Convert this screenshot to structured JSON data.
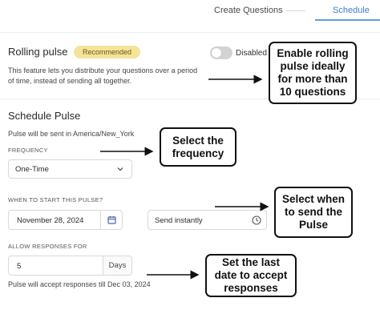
{
  "tabs": {
    "create_questions": "Create Questions",
    "schedule": "Schedule",
    "active": "Schedule"
  },
  "rolling_pulse": {
    "title": "Rolling pulse",
    "badge": "Recommended",
    "toggle_label": "Disabled",
    "toggle_enabled": false,
    "description": "This feature lets you distribute your questions over a period of time, instead of sending all together."
  },
  "schedule_pulse": {
    "title": "Schedule Pulse",
    "timezone_note": "Pulse will be sent in America/New_York",
    "frequency": {
      "label": "FREQUENCY",
      "value": "One-Time"
    },
    "when_to_start": {
      "label": "WHEN TO START THIS PULSE?",
      "date_value": "November 28, 2024",
      "send_value": "Send instantly"
    },
    "allow_responses": {
      "label": "ALLOW RESPONSES FOR",
      "value": "5",
      "unit": "Days"
    },
    "accept_note": "Pulse will accept responses till Dec 03, 2024"
  },
  "callouts": {
    "rolling": "Enable rolling pulse ideally for more than 10 questions",
    "frequency": "Select the frequency",
    "send_time": "Select when to send the Pulse",
    "last_date": "Set the last date to accept responses"
  },
  "colors": {
    "accent": "#5aa0d8",
    "badge_bg": "#f6e39a",
    "calendar_icon": "#4a63b8"
  },
  "icons": {
    "frequency_dropdown": "chevron-down-icon",
    "date_picker": "calendar-icon",
    "send_time": "clock-icon"
  }
}
